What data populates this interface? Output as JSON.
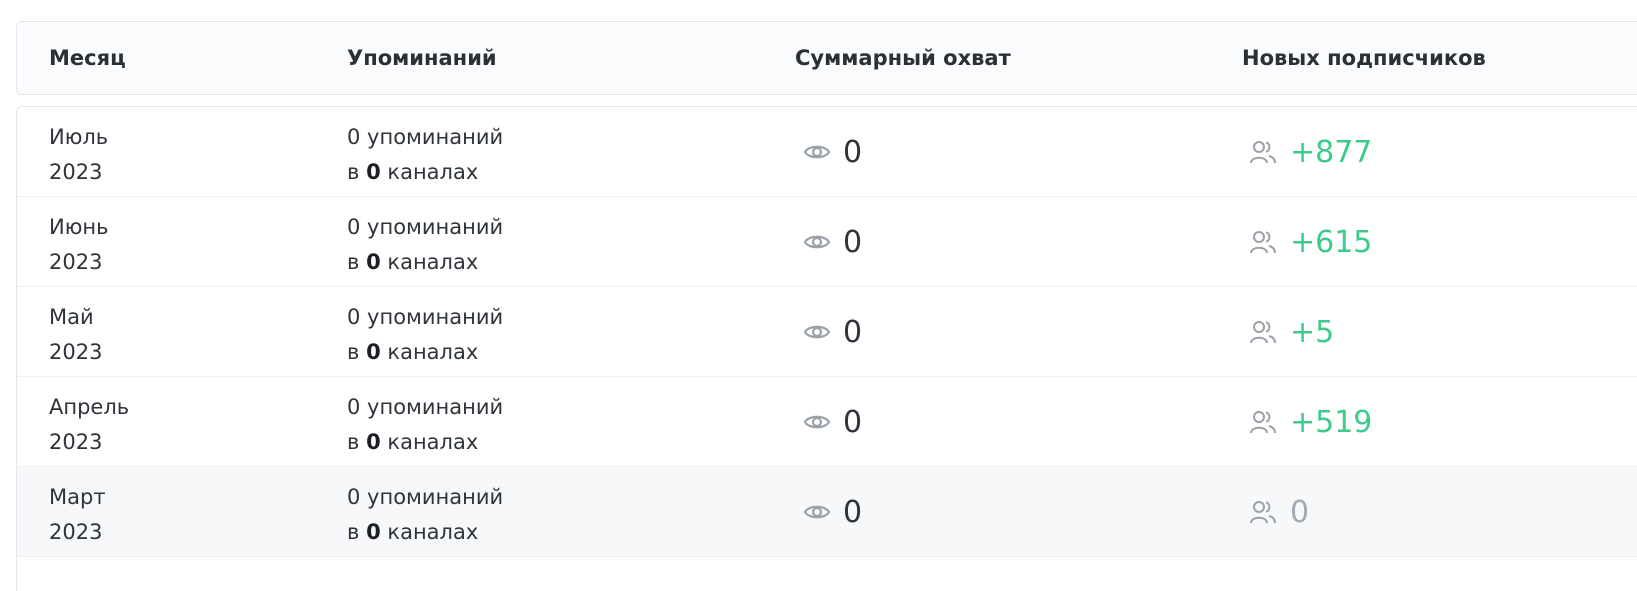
{
  "header": {
    "columns": [
      "Месяц",
      "Упоминаний",
      "Суммарный охват",
      "Новых подписчиков"
    ]
  },
  "colors": {
    "positive": "#3ccb8b",
    "neutral": "#a3aab3",
    "icon": "#9aa1a9"
  },
  "icons": {
    "reach": "eye-icon",
    "subscribers": "users-icon"
  },
  "rows": [
    {
      "month": "Июль",
      "year": "2023",
      "mentions_line": "0 упоминаний",
      "channels_prefix": "в",
      "channels_count": "0",
      "channels_suffix": "каналах",
      "reach": "0",
      "subscribers": "+877",
      "subscribers_state": "positive"
    },
    {
      "month": "Июнь",
      "year": "2023",
      "mentions_line": "0 упоминаний",
      "channels_prefix": "в",
      "channels_count": "0",
      "channels_suffix": "каналах",
      "reach": "0",
      "subscribers": "+615",
      "subscribers_state": "positive"
    },
    {
      "month": "Май",
      "year": "2023",
      "mentions_line": "0 упоминаний",
      "channels_prefix": "в",
      "channels_count": "0",
      "channels_suffix": "каналах",
      "reach": "0",
      "subscribers": "+5",
      "subscribers_state": "positive"
    },
    {
      "month": "Апрель",
      "year": "2023",
      "mentions_line": "0 упоминаний",
      "channels_prefix": "в",
      "channels_count": "0",
      "channels_suffix": "каналах",
      "reach": "0",
      "subscribers": "+519",
      "subscribers_state": "positive"
    },
    {
      "month": "Март",
      "year": "2023",
      "mentions_line": "0 упоминаний",
      "channels_prefix": "в",
      "channels_count": "0",
      "channels_suffix": "каналах",
      "reach": "0",
      "subscribers": "0",
      "subscribers_state": "neutral"
    }
  ]
}
